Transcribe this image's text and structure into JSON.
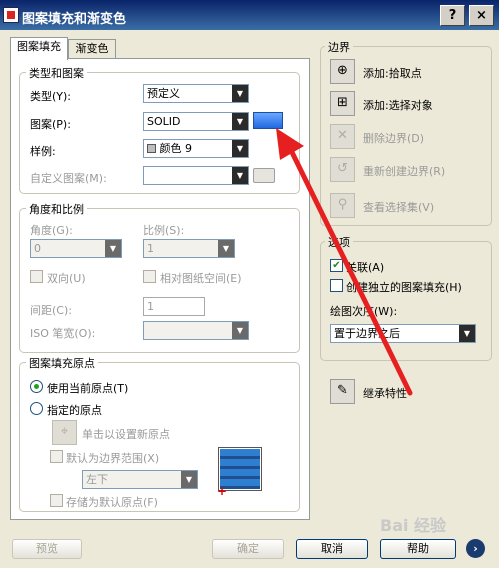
{
  "window": {
    "title": "图案填充和渐变色",
    "help_btn": "?",
    "close_btn": "×"
  },
  "tabs": [
    {
      "label": "图案填充",
      "active": true
    },
    {
      "label": "渐变色",
      "active": false
    }
  ],
  "type_pattern": {
    "group_label": "类型和图案",
    "type_label": "类型(Y):",
    "type_value": "预定义",
    "pattern_label": "图案(P):",
    "pattern_value": "SOLID",
    "swatch_label": "样例:",
    "swatch_value": "颜色 9",
    "custom_label": "自定义图案(M):",
    "custom_value": ""
  },
  "angle_scale": {
    "group_label": "角度和比例",
    "angle_label": "角度(G):",
    "angle_value": "0",
    "scale_label": "比例(S):",
    "scale_value": "1",
    "double_label": "双向(U)",
    "relative_label": "相对图纸空间(E)",
    "spacing_label": "间距(C):",
    "spacing_value": "1",
    "iso_label": "ISO 笔宽(O):",
    "iso_value": ""
  },
  "origin": {
    "group_label": "图案填充原点",
    "use_current_label": "使用当前原点(T)",
    "specified_label": "指定的原点",
    "click_set_label": "单击以设置新原点",
    "default_extent_label": "默认为边界范围(X)",
    "extent_value": "左下",
    "store_default_label": "存储为默认原点(F)"
  },
  "boundary": {
    "group_label": "边界",
    "add_pick_label": "添加:拾取点",
    "add_select_label": "添加:选择对象",
    "remove_label": "删除边界(D)",
    "recreate_label": "重新创建边界(R)",
    "view_selection_label": "查看选择集(V)"
  },
  "options": {
    "group_label": "选项",
    "associative_label": "关联(A)",
    "independent_label": "创建独立的图案填充(H)",
    "draw_order_label": "绘图次序(W):",
    "draw_order_value": "置于边界之后"
  },
  "inherit_label": "继承特性",
  "buttons": {
    "preview": "预览",
    "ok": "确定",
    "cancel": "取消",
    "help": "帮助"
  },
  "watermark": "Bai 经验"
}
